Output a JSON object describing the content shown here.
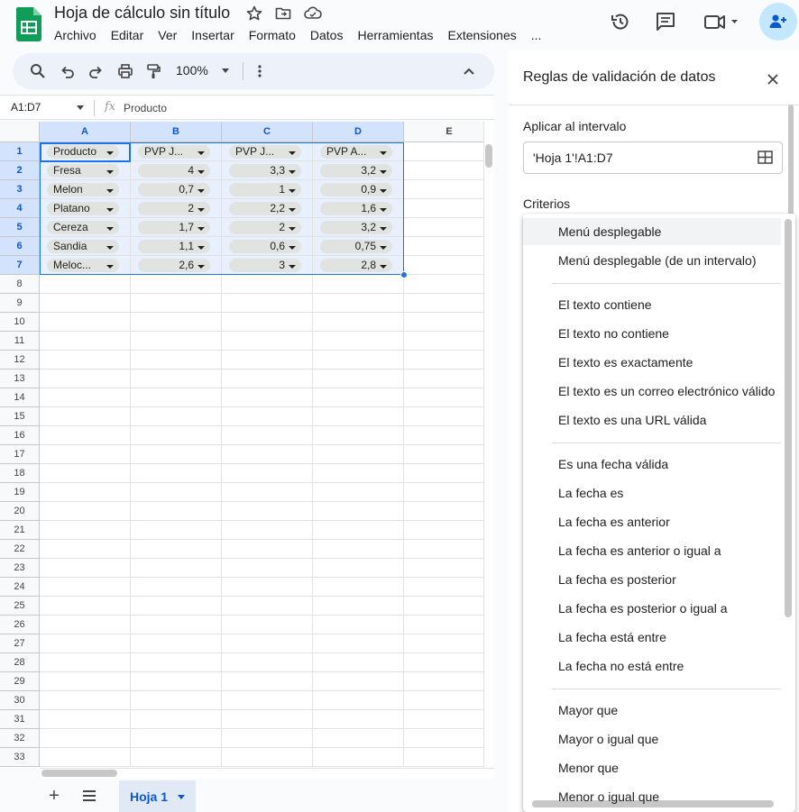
{
  "app": {
    "doc_title": "Hoja de cálculo sin título",
    "menus": [
      "Archivo",
      "Editar",
      "Ver",
      "Insertar",
      "Formato",
      "Datos",
      "Herramientas",
      "Extensiones",
      "..."
    ]
  },
  "toolbar": {
    "zoom": "100%"
  },
  "formula_bar": {
    "name_box": "A1:D7",
    "fx": "fx",
    "content": "Producto"
  },
  "grid": {
    "columns": [
      "A",
      "B",
      "C",
      "D",
      "E"
    ],
    "rows": [
      "1",
      "2",
      "3",
      "4",
      "5",
      "6",
      "7",
      "8",
      "9",
      "10",
      "11",
      "12",
      "13",
      "14",
      "15",
      "16",
      "17",
      "18",
      "19",
      "20",
      "21",
      "22",
      "23",
      "24",
      "25",
      "26",
      "27",
      "28",
      "29",
      "30",
      "31",
      "32",
      "33"
    ],
    "data": [
      [
        "Producto",
        "PVP J...",
        "PVP J...",
        "PVP A..."
      ],
      [
        "Fresa",
        "4",
        "3,3",
        "3,2"
      ],
      [
        "Melon",
        "0,7",
        "1",
        "0,9"
      ],
      [
        "Platano",
        "2",
        "2,2",
        "1,6"
      ],
      [
        "Cereza",
        "1,7",
        "2",
        "3,2"
      ],
      [
        "Sandia",
        "1,1",
        "0,6",
        "0,75"
      ],
      [
        "Meloc...",
        "2,6",
        "3",
        "2,8"
      ]
    ]
  },
  "sheets": {
    "add": "+",
    "active": "Hoja 1"
  },
  "panel": {
    "title": "Reglas de validación de datos",
    "range_label": "Aplicar al intervalo",
    "range_value": "'Hoja 1'!A1:D7",
    "criteria_label": "Criterios"
  },
  "criteria_menu": {
    "groups": [
      [
        "Menú desplegable",
        "Menú desplegable (de un intervalo)"
      ],
      [
        "El texto contiene",
        "El texto no contiene",
        "El texto es exactamente",
        "El texto es un correo electrónico válido",
        "El texto es una URL válida"
      ],
      [
        "Es una fecha válida",
        "La fecha es",
        "La fecha es anterior",
        "La fecha es anterior o igual a",
        "La fecha es posterior",
        "La fecha es posterior o igual a",
        "La fecha está entre",
        "La fecha no está entre"
      ],
      [
        "Mayor que",
        "Mayor o igual que",
        "Menor que",
        "Menor o igual que"
      ]
    ],
    "highlighted": "Menú desplegable"
  },
  "colors": {
    "accent": "#1a73e8",
    "selection_fill": "#e8f0fe",
    "header_selected": "#d3e3fd",
    "chip": "#e1e3e1",
    "sheets_green": "#0f9d58"
  }
}
